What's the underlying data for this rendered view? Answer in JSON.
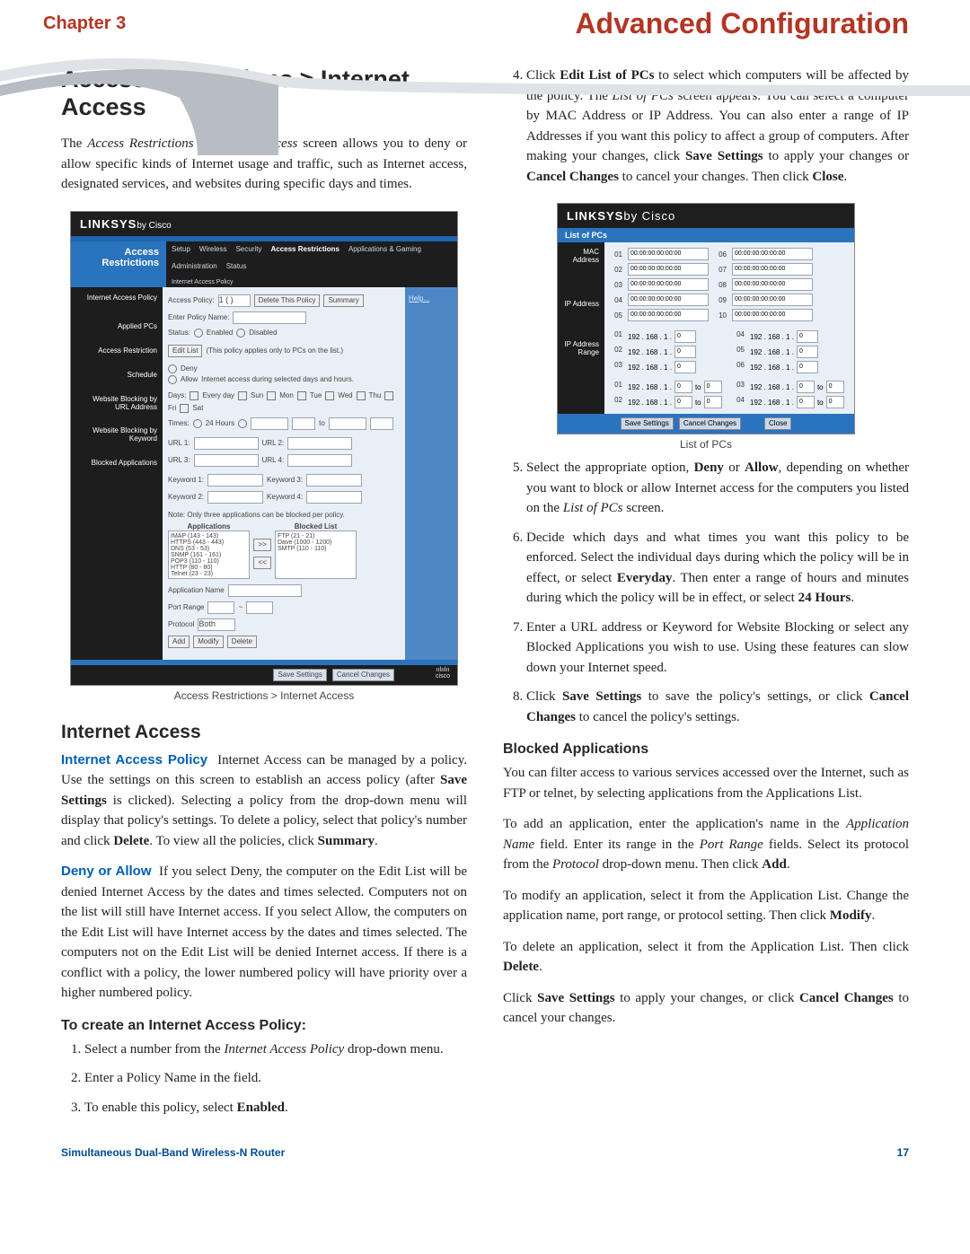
{
  "header": {
    "chapter": "Chapter 3",
    "title": "Advanced Configuration"
  },
  "left": {
    "h1": "Access Restrictions > Internet Access",
    "intro": "The Access Restrictions > Internet Access screen allows you to deny or allow specific kinds of Internet usage and traffic, such as Internet access, designated services, and websites during specific days and times.",
    "fig_caption": "Access Restrictions > Internet Access",
    "h2": "Internet Access",
    "iap_lead": "Internet Access Policy",
    "iap_body": "Internet Access can be managed by a policy. Use the settings on this screen to establish an access policy (after Save Settings is clicked). Selecting a policy from the drop-down menu will display that policy's settings. To delete a policy, select that policy's number and click Delete. To view all the policies, click Summary.",
    "deny_lead": "Deny or Allow",
    "deny_body": "If you select Deny, the computer on the Edit List will be denied Internet Access by the dates and times selected. Computers not on the list will still have Internet access. If you select Allow, the computers on the Edit List will have Internet access by the dates and times selected. The computers not on the Edit List will be denied Internet access. If there is a conflict with a policy, the lower numbered policy will have priority over a higher numbered policy.",
    "h3_create": "To create an Internet Access Policy:",
    "steps_left": [
      "Select a number from the Internet Access Policy drop-down menu.",
      "Enter a Policy Name in the field.",
      "To enable this policy, select Enabled."
    ]
  },
  "right": {
    "step4": "Click Edit List of PCs to select which computers will be affected by the policy. The List of PCs screen appears. You can select a computer by MAC Address or IP Address. You can also enter a range of IP Addresses if you want this policy to affect a group of computers. After making your changes, click Save Settings to apply your changes or Cancel Changes to cancel your changes. Then click Close.",
    "fig2_caption": "List of PCs",
    "step5": "Select the appropriate option, Deny or Allow, depending on whether you want to block or allow Internet access for the computers you listed on the List of PCs screen.",
    "step6": "Decide which days and what times you want this policy to be enforced. Select the individual days during which the policy will be in effect, or select Everyday. Then enter a range of hours and minutes during which the policy will be in effect, or select 24 Hours.",
    "step7": "Enter a URL address or Keyword for Website Blocking or select any Blocked Applications you wish to use. Using these features can slow down your Internet speed.",
    "step8": "Click Save Settings to save the policy's settings, or click Cancel Changes to cancel the policy's settings.",
    "h3_blocked": "Blocked Applications",
    "blocked_p1": "You can filter access to various services accessed over the Internet, such as FTP or telnet, by selecting applications from the Applications List.",
    "blocked_p2": "To add an application, enter the application's name in the Application Name field. Enter its range in the Port Range fields. Select its protocol from the Protocol drop-down menu. Then click Add.",
    "blocked_p3": "To modify an application, select it from the Application List. Change the application name, port range, or protocol setting. Then click Modify.",
    "blocked_p4": "To delete an application, select it from the Application List. Then click Delete.",
    "blocked_p5": "Click Save Settings to apply your changes, or click Cancel Changes to cancel your changes."
  },
  "footer": {
    "product": "Simultaneous Dual-Band Wireless-N Router",
    "page": "17"
  },
  "shot1": {
    "brand_main": "LINKSYS",
    "brand_by": "by Cisco",
    "side_title": "Access Restrictions",
    "tabs": [
      "Setup",
      "Wireless",
      "Security",
      "Access Restrictions",
      "Applications & Gaming",
      "Administration",
      "Status"
    ],
    "subtab": "Internet Access Policy",
    "labels": [
      "Internet Access Policy",
      "Applied PCs",
      "Access Restriction",
      "Schedule",
      "Website Blocking by URL Address",
      "Website Blocking by Keyword",
      "Blocked Applications"
    ],
    "access_policy_label": "Access Policy:",
    "policy_opt": "1 ( )",
    "btn_delete_policy": "Delete This Policy",
    "btn_summary": "Summary",
    "enter_policy": "Enter Policy Name:",
    "status": "Status:",
    "enabled": "Enabled",
    "disabled": "Disabled",
    "edit_list": "Edit List",
    "applies_note": "(This policy applies only to PCs on the list.)",
    "deny": "Deny",
    "allow": "Allow",
    "deny_note": "Internet access during selected days and hours.",
    "days": "Days:",
    "everyday": "Every day",
    "dow": [
      "Sun",
      "Mon",
      "Tue",
      "Wed",
      "Thu",
      "Fri",
      "Sat"
    ],
    "times": "Times:",
    "t24": "24 Hours",
    "to": "to",
    "url": [
      "URL 1:",
      "URL 2:",
      "URL 3:",
      "URL 4:"
    ],
    "kw": [
      "Keyword 1:",
      "Keyword 2:",
      "Keyword 3:",
      "Keyword 4:"
    ],
    "apps_note": "Note: Only three applications can be blocked per policy.",
    "apps_h": "Applications",
    "blocked_h": "Blocked List",
    "apps_list": [
      "IMAP (143 - 143)",
      "HTTPS (443 - 443)",
      "DNS (53 - 53)",
      "SNMP (161 - 161)",
      "POP3 (110 - 110)",
      "HTTP (80 - 80)",
      "Telnet (23 - 23)"
    ],
    "blocked_list": [
      "FTP (21 - 21)",
      "Dave (1000 - 1200)",
      "SMTP (110 - 110)"
    ],
    "app_name": "Application Name",
    "port_range": "Port Range",
    "protocol": "Protocol",
    "proto_opt": "Both",
    "btn_add": "Add",
    "btn_modify": "Modify",
    "btn_delete": "Delete",
    "save": "Save Settings",
    "cancel": "Cancel Changes",
    "help": "Help...",
    "cisco": "cisco"
  },
  "shot2": {
    "brand_main": "LINKSYS",
    "brand_by": "by Cisco",
    "section": "List of PCs",
    "mac_h": "MAC Address",
    "ip_h": "IP Address",
    "range_h": "IP Address Range",
    "mac_ids": [
      "01",
      "02",
      "03",
      "04",
      "05",
      "06",
      "07",
      "08",
      "09",
      "10"
    ],
    "mac_vals": [
      "00:00:00:00:00:00",
      "00:00:00:00:00:00",
      "00:00:00:00:00:00",
      "00:00:00:00:00:00",
      "00:00:00:00:00:00"
    ],
    "ip_ids": [
      "01",
      "02",
      "03",
      "04",
      "05",
      "06"
    ],
    "ip_prefix": "192 . 168 . 1 .",
    "ip_last": "0",
    "range_ids": [
      "01",
      "02",
      "03",
      "04"
    ],
    "range_prefix": "192 . 168 . 1 .",
    "range_to": "to",
    "save": "Save Settings",
    "cancel": "Cancel Changes",
    "close": "Close"
  }
}
